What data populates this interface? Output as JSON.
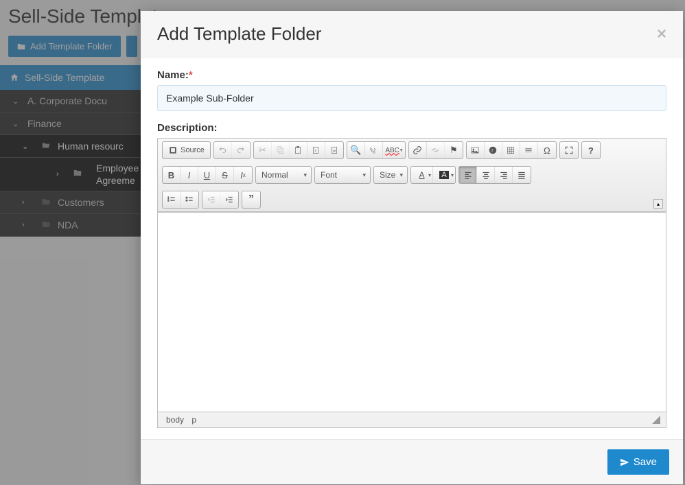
{
  "page": {
    "title": "Sell-Side Template"
  },
  "toolbar": {
    "add_folder": "Add Template Folder"
  },
  "tree": {
    "root": "Sell-Side Template",
    "items": [
      {
        "label": "A. Corporate Docu"
      },
      {
        "label": "Finance"
      },
      {
        "label": "Human resourc",
        "active": true
      },
      {
        "label": "Employee Agreeme",
        "sub": true
      },
      {
        "label": "Customers"
      },
      {
        "label": "NDA"
      }
    ]
  },
  "modal": {
    "title": "Add Template Folder",
    "name_label": "Name:",
    "name_value": "Example Sub-Folder",
    "desc_label": "Description:",
    "save": "Save"
  },
  "editor": {
    "source": "Source",
    "normal": "Normal",
    "font": "Font",
    "size": "Size",
    "path": [
      "body",
      "p"
    ]
  }
}
